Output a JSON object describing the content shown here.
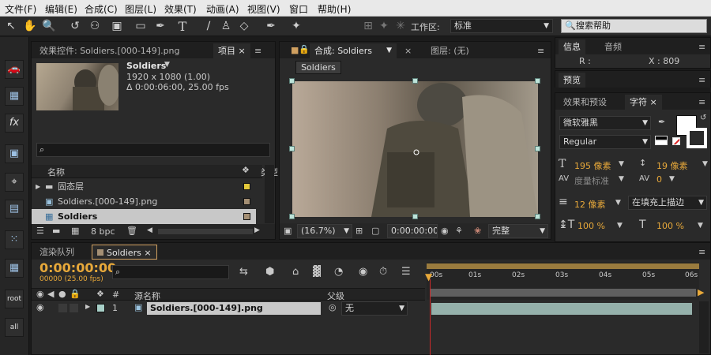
{
  "menu": [
    "文件(F)",
    "编辑(E)",
    "合成(C)",
    "图层(L)",
    "效果(T)",
    "动画(A)",
    "视图(V)",
    "窗口",
    "帮助(H)"
  ],
  "toolbar": {
    "workspace_label": "工作区:",
    "workspace_value": "标准",
    "help_search_placeholder": "搜索帮助"
  },
  "project_panel": {
    "tab_effects": "效果控件: Soldiers.[000-149].png",
    "tab_project": "项目",
    "selected_name": "Soldiers",
    "selected_dims": "1920 x 1080 (1.00)",
    "selected_duration": "Δ 0:00:06:00, 25.00 fps",
    "search_placeholder": "",
    "col_name": "名称",
    "col_type": "类型",
    "items": [
      {
        "name": "固态层",
        "kind": "folder",
        "color": "#e3c93a"
      },
      {
        "name": "Soldiers.[000-149].png",
        "kind": "footage",
        "color": "#a48f74"
      },
      {
        "name": "Soldiers",
        "kind": "composition",
        "color": "#a48f74",
        "selected": true
      }
    ],
    "bpc": "8 bpc"
  },
  "comp_panel": {
    "tab_comp": "合成: Soldiers",
    "tab_layer": "图层: (无)",
    "comp_button": "Soldiers",
    "zoom": "(16.7%)",
    "timecode": "0:00:00:00",
    "quality": "完整"
  },
  "info_panel": {
    "tab_info": "信息",
    "tab_audio": "音频",
    "r_label": "R :",
    "x_label": "X : 809",
    "tab_preview": "预览"
  },
  "character_panel": {
    "tab_effects_presets": "效果和预设",
    "tab_character": "字符",
    "font_family": "微软雅黑",
    "font_style": "Regular",
    "font_size": "195 像素",
    "leading": "19 像素",
    "kerning": "度量标准",
    "tracking": "0",
    "stroke_width": "12 像素",
    "stroke_mode": "在填充上描边",
    "vert_scale": "100 %",
    "horiz_scale": "100 %",
    "fill_color": "#ffffff",
    "stroke_color": "#ffffff"
  },
  "left_tools": [
    "car-icon",
    "image-grid-icon",
    "fx-icon",
    "image-icon",
    "target-icon",
    "text-box-icon",
    "dots-icon",
    "grid-icon",
    "root-icon",
    "all-icon"
  ],
  "left_tool_labels": {
    "fx": "fx",
    "root": "root",
    "all": "all"
  },
  "timeline": {
    "tab_render": "渲染队列",
    "tab_comp": "Soldiers",
    "timecode": "0:00:00:00",
    "frame_info": "00000 (25.00 fps)",
    "search_placeholder": "",
    "col_hash": "#",
    "col_source": "源名称",
    "col_parent": "父级",
    "ruler_labels": [
      "00s",
      "01s",
      "02s",
      "03s",
      "04s",
      "05s",
      "06s"
    ],
    "layers": [
      {
        "index": "1",
        "name": "Soldiers.[000-149].png",
        "parent": "无",
        "color": "#a8d0c8"
      }
    ]
  }
}
